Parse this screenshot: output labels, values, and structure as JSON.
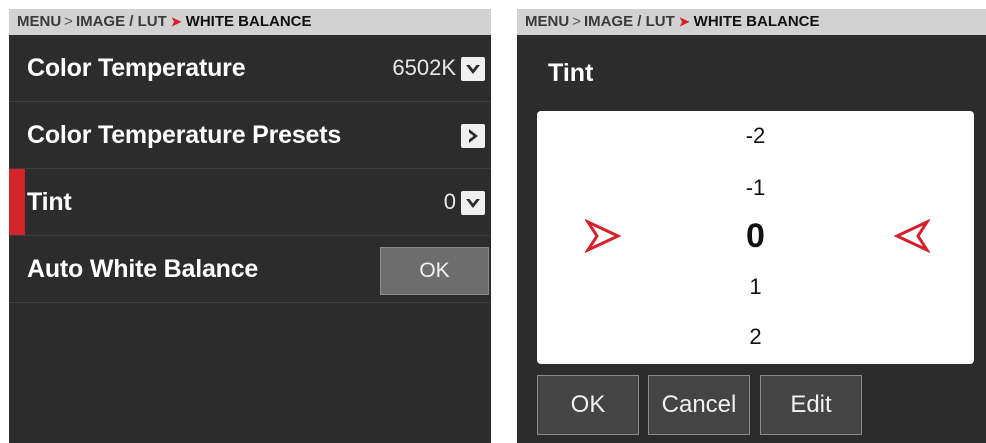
{
  "left": {
    "breadcrumb": {
      "menu": "MENU",
      "sep1": ">",
      "section": "IMAGE / LUT",
      "sep2": "➤",
      "current": "WHITE BALANCE"
    },
    "rows": [
      {
        "label": "Color Temperature",
        "value": "6502K",
        "control": "dropdown"
      },
      {
        "label": "Color Temperature Presets",
        "value": "",
        "control": "submenu"
      },
      {
        "label": "Tint",
        "value": "0",
        "control": "dropdown",
        "selected": true
      },
      {
        "label": "Auto White Balance",
        "button": "OK"
      }
    ]
  },
  "right": {
    "breadcrumb": {
      "menu": "MENU",
      "sep1": ">",
      "section": "IMAGE / LUT",
      "sep2": "➤",
      "current": "WHITE BALANCE"
    },
    "title": "Tint",
    "picker": {
      "options": [
        "-2",
        "-1",
        "0",
        "1",
        "2"
      ],
      "selected": "0"
    },
    "buttons": {
      "ok": "OK",
      "cancel": "Cancel",
      "edit": "Edit"
    }
  },
  "colors": {
    "accent": "#d3242c",
    "panel": "#2c2c2c",
    "crumb_bar": "#d2d2d2"
  },
  "icons": [
    "chevron-down-icon",
    "chevron-right-icon",
    "arrow-right-icon",
    "arrow-left-icon"
  ]
}
